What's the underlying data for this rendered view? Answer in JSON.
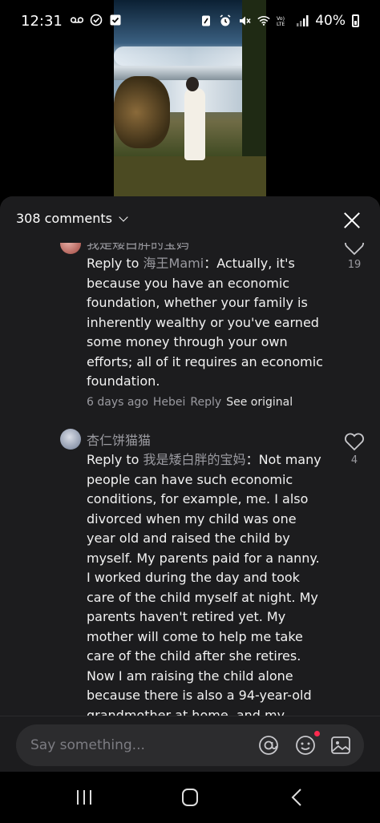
{
  "status_bar": {
    "time": "12:31",
    "battery": "40%",
    "icons": [
      "voicemail-icon",
      "check-circle-icon",
      "checkbox-icon",
      "nfc-icon",
      "alarm-icon",
      "mute-icon",
      "wifi-icon",
      "volte-icon",
      "signal-icon",
      "battery-icon"
    ]
  },
  "video": {
    "scene": "woman in white dress holding child by the sea"
  },
  "sheet": {
    "comment_count": "308 comments",
    "close_icon": "close-icon"
  },
  "comments": [
    {
      "username": "我是矮白胖的宝妈",
      "reply_prefix": "Reply to ",
      "reply_to": "海王Mami",
      "separator": "：",
      "text": "Actually, it's because you have an economic foundation, whether your family is inherently wealthy or you've earned some money through your own efforts; all of it requires an economic foundation.",
      "time": "6 days ago",
      "location": "Hebei",
      "reply_label": "Reply",
      "see_original": "See original",
      "likes": "19"
    },
    {
      "username": "杏仁饼猫猫",
      "reply_prefix": "Reply to ",
      "reply_to": "我是矮白胖的宝妈",
      "separator": "：",
      "text": "Not many people can have such economic conditions, for example, me. I also divorced when my child was one year old and raised the child by myself. My parents paid for a nanny. I worked during the day and took care of the child myself at night. My parents haven't retired yet. My mother will come to help me take care of the child after she retires. Now I am raising the child alone because there is also a 94-year-old grandmother at home, and my father's health is not so",
      "likes": "4"
    }
  ],
  "input": {
    "placeholder": "Say something...",
    "icons": [
      "at-icon",
      "emoji-icon",
      "image-icon"
    ]
  },
  "nav": {
    "icons": [
      "recent-apps-icon",
      "home-icon",
      "back-icon"
    ]
  },
  "colors": {
    "sheet_bg": "#1c1c1e",
    "muted_text": "#9a9aa0",
    "notification_dot": "#ff2a4f"
  }
}
